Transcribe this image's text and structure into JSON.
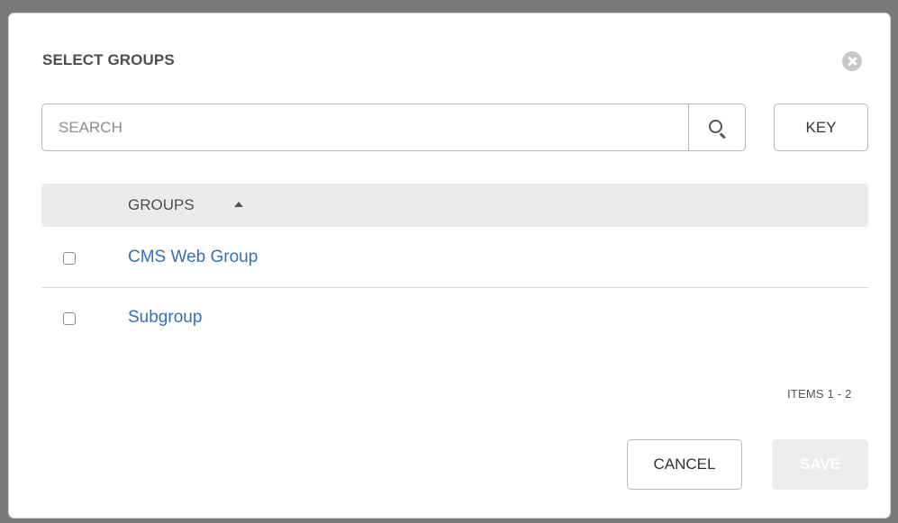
{
  "modal": {
    "title": "SELECT GROUPS"
  },
  "search": {
    "placeholder": "SEARCH",
    "value": ""
  },
  "key_button": {
    "label": "KEY"
  },
  "table": {
    "column_header": "GROUPS",
    "sort_direction": "ascending",
    "rows": [
      {
        "name": "CMS Web Group",
        "checked": false
      },
      {
        "name": "Subgroup",
        "checked": false
      }
    ]
  },
  "pagination": {
    "label": "ITEMS  1 - 2"
  },
  "footer": {
    "cancel_label": "CANCEL",
    "save_label": "SAVE",
    "save_enabled": false
  },
  "icons": {
    "close": "close-circle-icon",
    "search": "search-icon",
    "sort": "caret-up-icon"
  },
  "colors": {
    "link": "#3571b3",
    "table_header_bg": "#ebebeb",
    "save_disabled_bg": "#ececec"
  }
}
